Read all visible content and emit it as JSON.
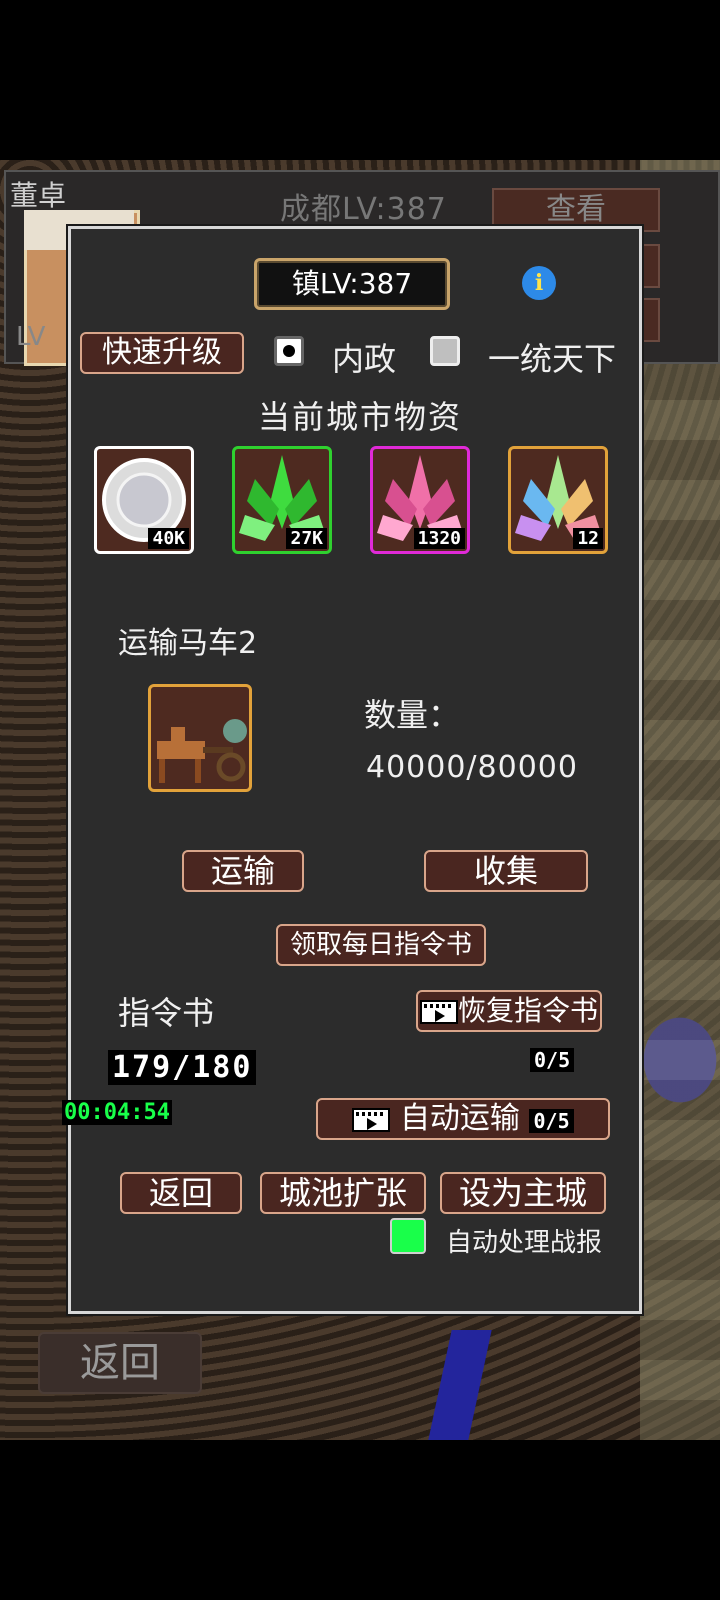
{
  "background": {
    "general_name": "董卓",
    "city_level": "成都LV:387",
    "view_button": "查看",
    "lv_label": "LV",
    "back_button": "返回"
  },
  "dialog": {
    "town_level": "镇LV:387",
    "quick_upgrade": "快速升级",
    "option_domestic": "内政",
    "option_unify": "一统天下",
    "resources_title": "当前城市物资",
    "resources": [
      {
        "name": "silver-plate",
        "count": "40K",
        "border": "#ffffff"
      },
      {
        "name": "green-crystal",
        "count": "27K",
        "border": "#2fd12f"
      },
      {
        "name": "pink-crystal",
        "count": "1320",
        "border": "#e02ad8"
      },
      {
        "name": "rainbow-crystal",
        "count": "12",
        "border": "#e2a23a"
      }
    ],
    "cart_title": "运输马车2",
    "quantity_label": "数量：",
    "quantity_value": "40000/80000",
    "transport_button": "运输",
    "collect_button": "收集",
    "daily_orders_button": "领取每日指令书",
    "orders_label": "指令书",
    "restore_orders_button": "恢复指令书",
    "orders_count": "179/180",
    "restore_count": "0/5",
    "timer": "00:04:54",
    "auto_transport_button": "自动运输",
    "auto_transport_count": "0/5",
    "return_button": "返回",
    "expand_button": "城池扩张",
    "set_main_city_button": "设为主城",
    "auto_battle_report_label": "自动处理战报",
    "auto_battle_report_checked": true
  },
  "colors": {
    "button_bg": "#4a2620",
    "button_border": "#d9a58a",
    "dialog_bg": "#2c2c2c",
    "timer_green": "#19ff4a",
    "checkbox_green": "#19ff4a"
  }
}
